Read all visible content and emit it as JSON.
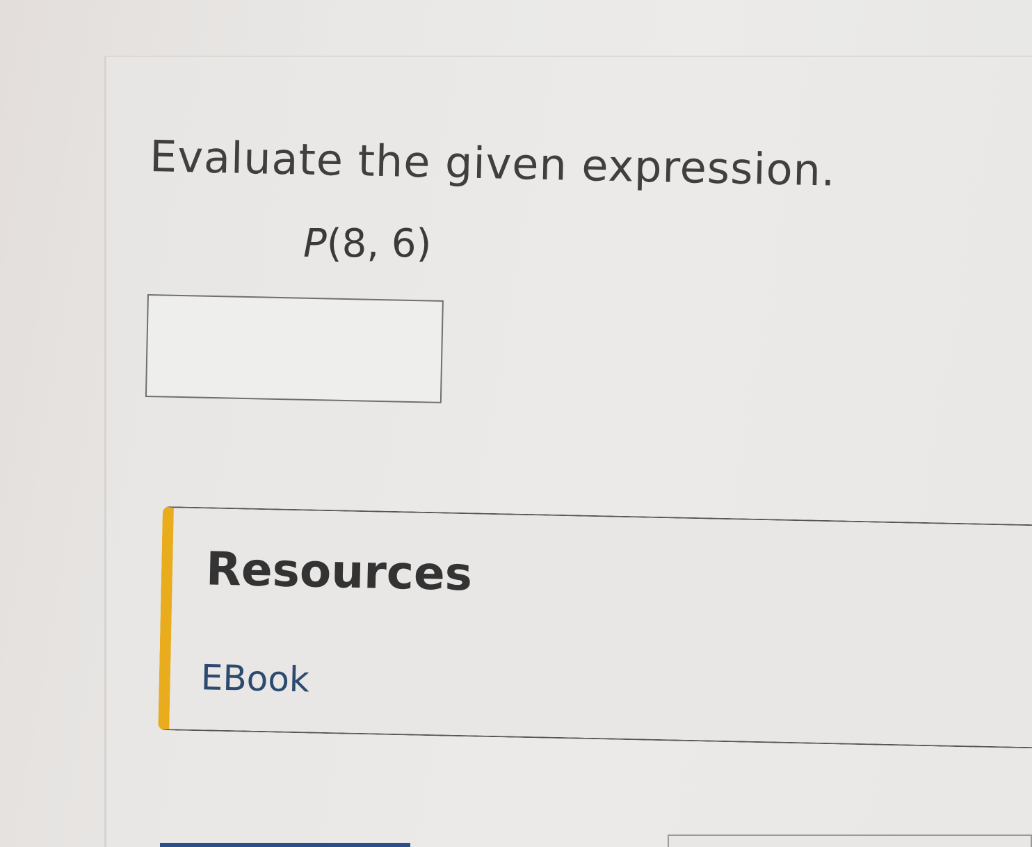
{
  "question": {
    "prompt": "Evaluate the given expression.",
    "expression_var": "P",
    "expression_args": "(8, 6)"
  },
  "answer": {
    "value": ""
  },
  "resources": {
    "title": "Resources",
    "ebook_label": "EBook"
  },
  "colors": {
    "resources_accent": "#e8ac1c",
    "link": "#2d4a6e",
    "bottom_bar": "#2a4f8a"
  }
}
